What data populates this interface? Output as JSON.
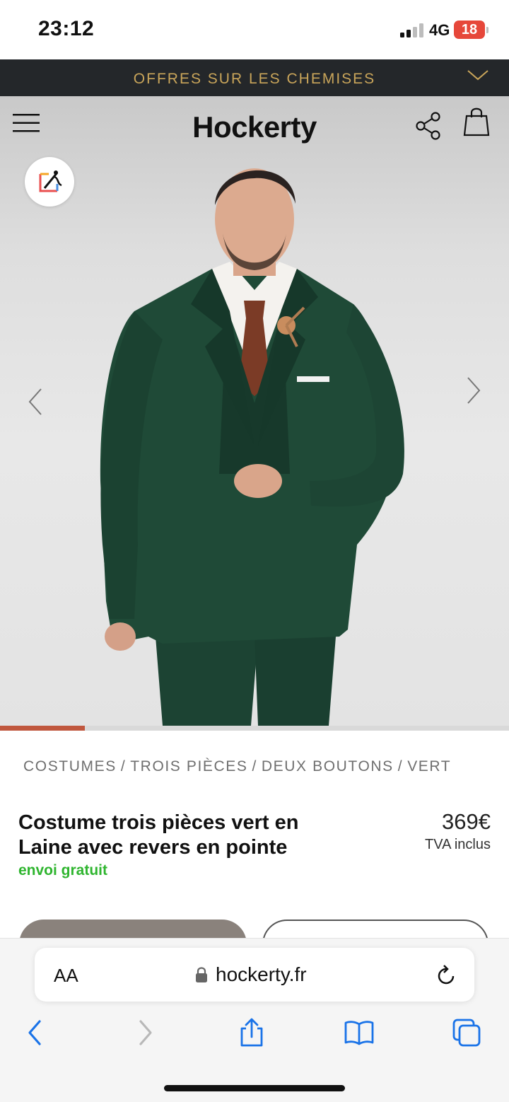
{
  "status_bar": {
    "time": "23:12",
    "network": "4G",
    "battery": "18"
  },
  "promo": {
    "text": "OFFRES SUR LES CHEMISES"
  },
  "header": {
    "logo": "Hockerty"
  },
  "gallery": {
    "progress": 0.167
  },
  "breadcrumb": {
    "items": [
      "COSTUMES",
      "TROIS PIÈCES",
      "DEUX BOUTONS",
      "VERT"
    ],
    "separator": "/"
  },
  "product": {
    "title": "Costume trois pièces vert en Laine avec revers en pointe",
    "shipping": "envoi gratuit",
    "price": "369€",
    "vat": "TVA inclus"
  },
  "browser": {
    "aa_label": "AA",
    "url": "hockerty.fr"
  },
  "colors": {
    "promo_bg": "#24272a",
    "promo_text": "#c9a55a",
    "progress_accent": "#c0573e",
    "shipping_green": "#2fb52f",
    "ios_blue": "#1a73e8",
    "suit_green": "#1f4a37"
  },
  "icons": [
    "signal-icon",
    "menu-icon",
    "share-icon",
    "shopping-bag-icon",
    "editor-icon",
    "chevron-left-icon",
    "chevron-right-icon",
    "lock-icon",
    "reload-icon",
    "back-icon",
    "forward-icon",
    "share-up-icon",
    "bookmarks-icon",
    "tabs-icon"
  ]
}
